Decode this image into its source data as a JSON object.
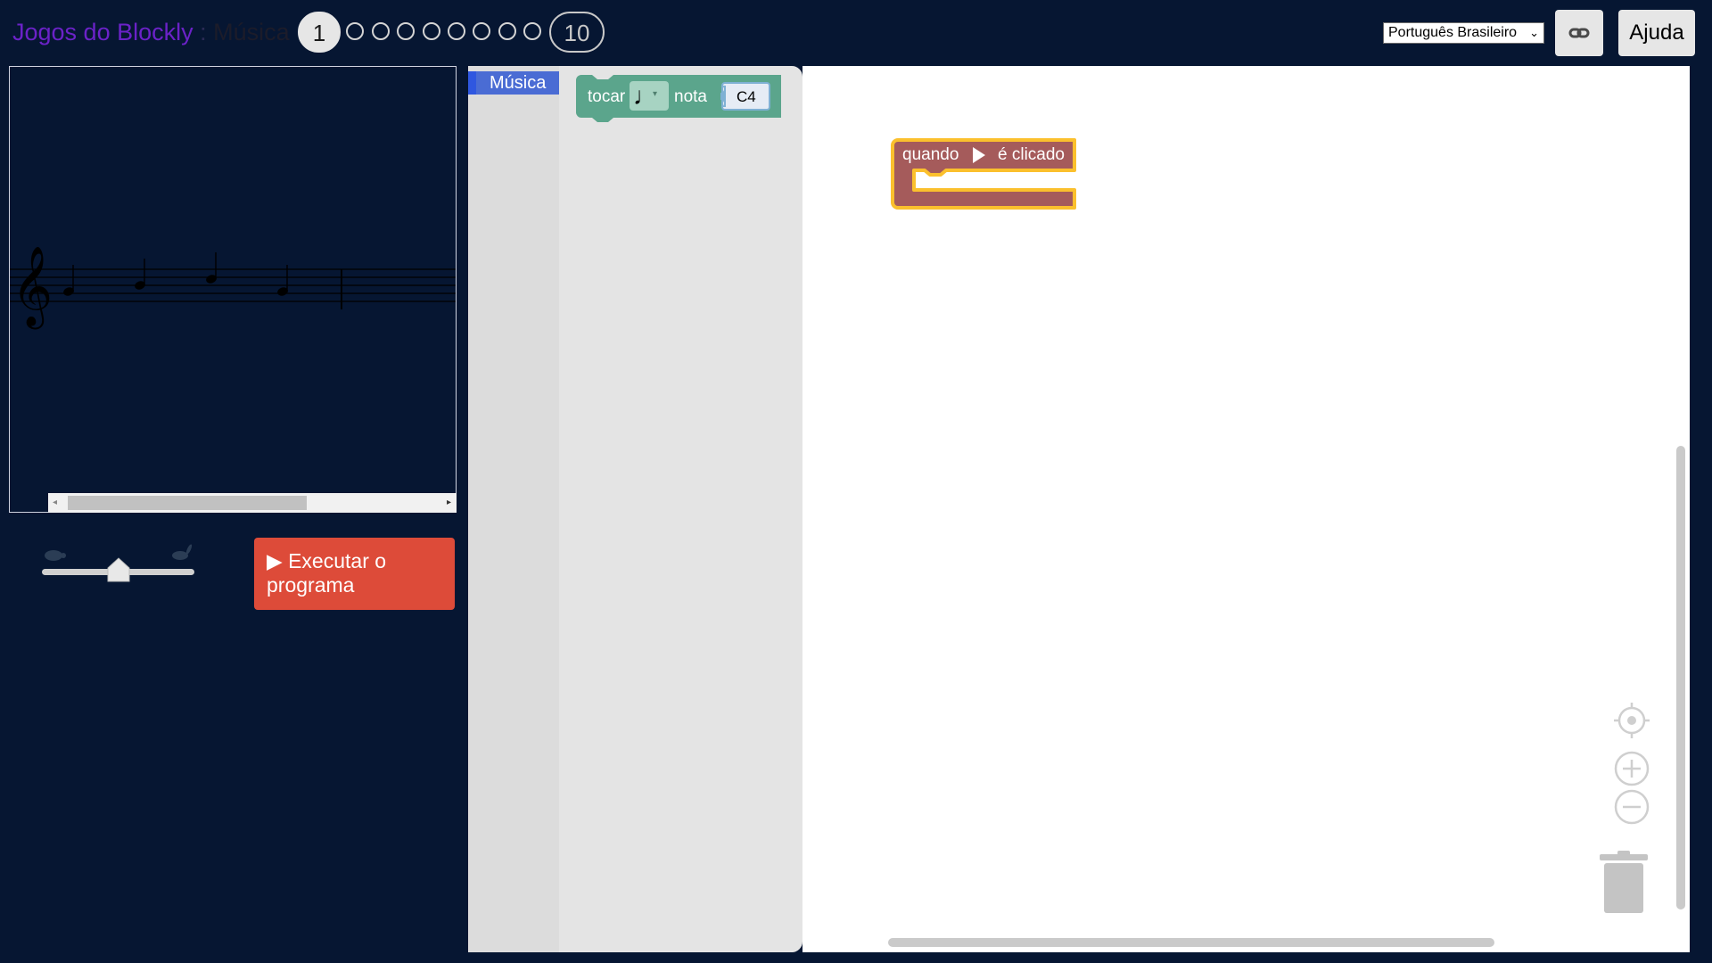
{
  "header": {
    "app_name": "Jogos do Blockly",
    "separator": " : ",
    "game_name": "Música",
    "levels": {
      "current": "1",
      "last": "10"
    },
    "language": "Português Brasileiro",
    "help_label": "Ajuda"
  },
  "visualization": {
    "note_count": 4
  },
  "controls": {
    "speed_level": 0.5,
    "run_icon": "▶",
    "run_label_line1": "Executar o",
    "run_label_line2": "programa"
  },
  "toolbox": {
    "category": "Música"
  },
  "flyout": {
    "block_play": {
      "label": "tocar",
      "note_label": "nota",
      "pitch": "C4",
      "duration_icon": "♩"
    }
  },
  "workspace": {
    "event_block": {
      "label_when": "quando",
      "label_clicked": "é clicado"
    }
  },
  "colors": {
    "background": "#061632",
    "run_button": "#dd4b39",
    "music_block": "#5ba58c",
    "event_block": "#a55b5b",
    "selection": "#fbc02d",
    "category": "#4a6cd4"
  }
}
